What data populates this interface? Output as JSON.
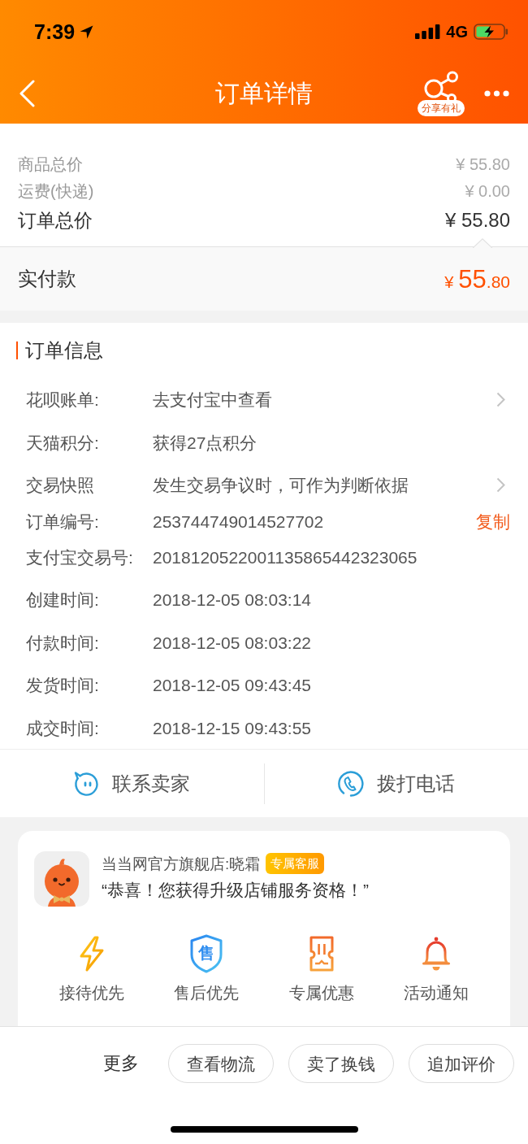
{
  "status_bar": {
    "time": "7:39",
    "network": "4G"
  },
  "nav_bar": {
    "title": "订单详情",
    "share_badge": "分享有礼"
  },
  "price_summary": {
    "rows": [
      {
        "kind": "subtotal",
        "label": "商品总价",
        "value": "¥ 55.80"
      },
      {
        "kind": "subtotal",
        "label": "运费(快递)",
        "value": "¥ 0.00"
      },
      {
        "kind": "total",
        "label": "订单总价",
        "value": "¥ 55.80"
      }
    ]
  },
  "payment": {
    "label": "实付款",
    "currency": "¥",
    "amount_integer": "55",
    "amount_decimal": ".80"
  },
  "order_info": {
    "title": "订单信息",
    "rows": [
      {
        "kind": "link",
        "label": "花呗账单:",
        "value": "去支付宝中查看"
      },
      {
        "kind": "plain",
        "label": "天猫积分:",
        "value": "获得27点积分"
      },
      {
        "kind": "link",
        "label": "交易快照",
        "value": "发生交易争议时，可作为判断依据"
      },
      {
        "kind": "copy",
        "label": "订单编号:",
        "value": "253744749014527702",
        "action": "复制"
      },
      {
        "kind": "plain",
        "label": "支付宝交易号:",
        "value": "2018120522001135865442323065"
      },
      {
        "kind": "plain",
        "label": "创建时间:",
        "value": "2018-12-05 08:03:14"
      },
      {
        "kind": "plain",
        "label": "付款时间:",
        "value": "2018-12-05 08:03:22"
      },
      {
        "kind": "plain",
        "label": "发货时间:",
        "value": "2018-12-05 09:43:45"
      },
      {
        "kind": "plain",
        "label": "成交时间:",
        "value": "2018-12-15 09:43:55"
      }
    ]
  },
  "contact_buttons": [
    {
      "kind": "chat",
      "label": "联系卖家"
    },
    {
      "kind": "phone",
      "label": "拨打电话"
    }
  ],
  "store_card": {
    "store_name": "当当网官方旗舰店:晓霜",
    "badge": "专属客服",
    "message": "“恭喜！您获得升级店铺服务资格！”",
    "benefits": [
      {
        "kind": "lightning",
        "label": "接待优先"
      },
      {
        "kind": "shield",
        "label": "售后优先",
        "icon_text": "售"
      },
      {
        "kind": "ticket",
        "label": "专属优惠"
      },
      {
        "kind": "bell",
        "label": "活动通知"
      }
    ]
  },
  "bottom_bar": {
    "more": "更多",
    "buttons": [
      "查看物流",
      "卖了换钱",
      "追加评价"
    ]
  }
}
